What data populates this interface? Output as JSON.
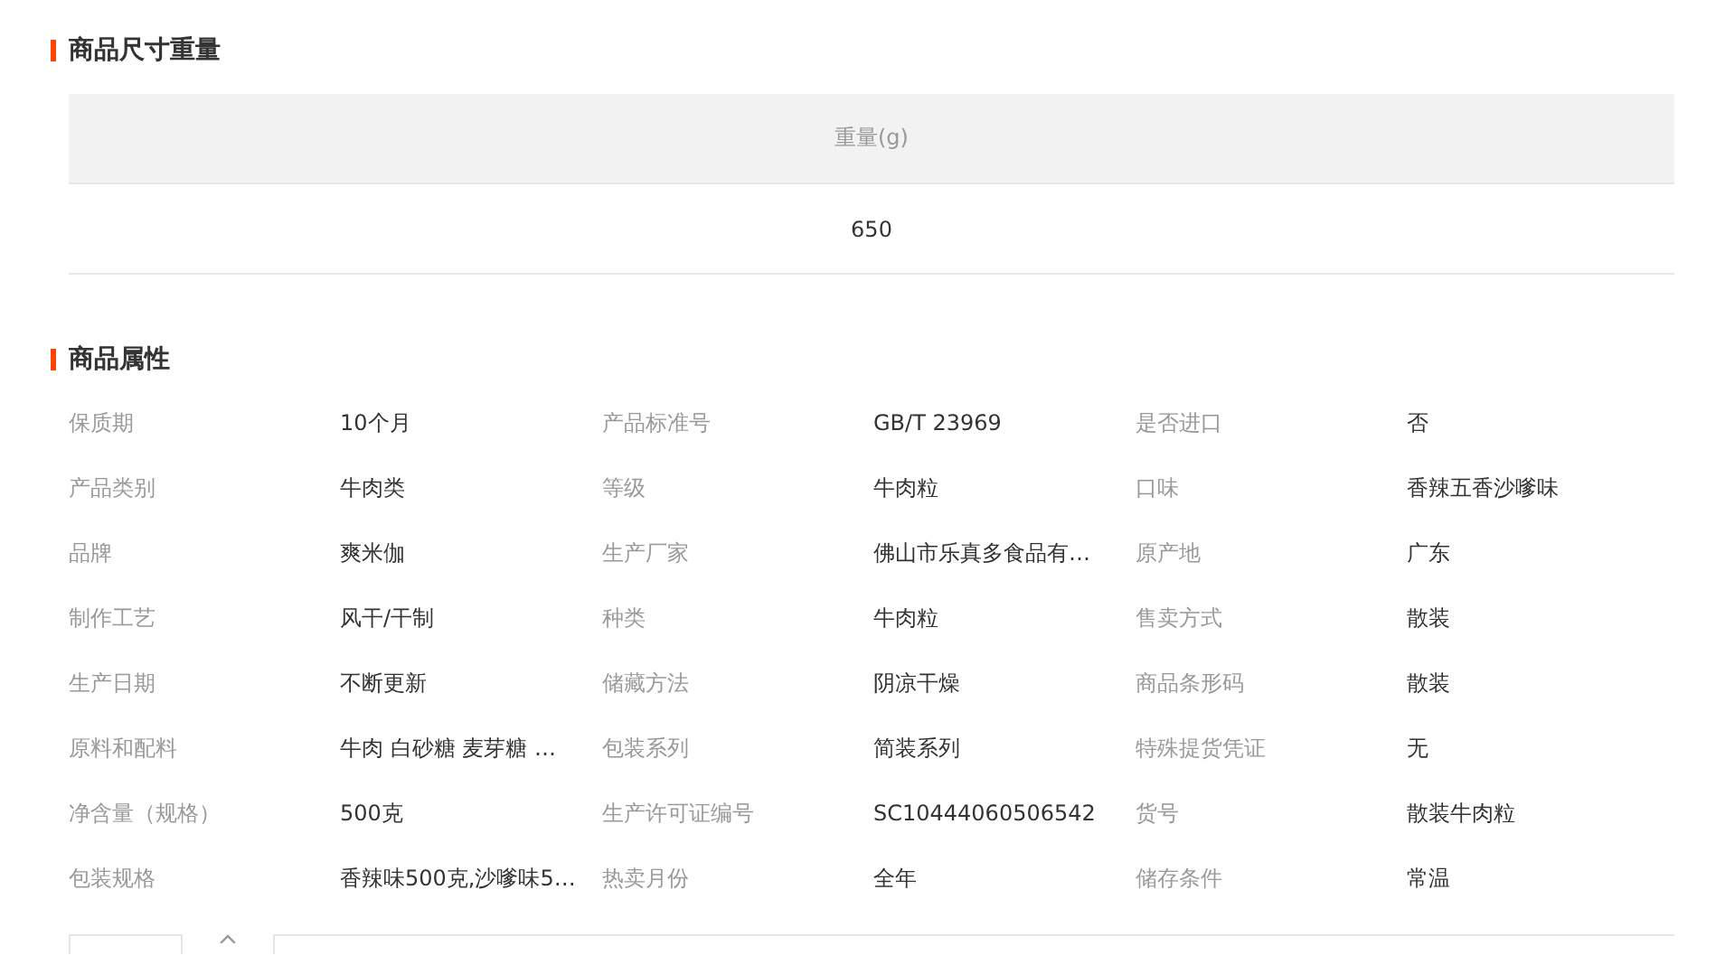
{
  "size_section": {
    "title": "商品尺寸重量",
    "columns": [
      "重量(g)"
    ],
    "rows": [
      [
        "650"
      ]
    ]
  },
  "attributes_section": {
    "title": "商品属性",
    "items": [
      {
        "label": "保质期",
        "value": "10个月"
      },
      {
        "label": "产品标准号",
        "value": "GB/T 23969"
      },
      {
        "label": "是否进口",
        "value": "否"
      },
      {
        "label": "产品类别",
        "value": "牛肉类"
      },
      {
        "label": "等级",
        "value": "牛肉粒"
      },
      {
        "label": "口味",
        "value": "香辣五香沙嗲味"
      },
      {
        "label": "品牌",
        "value": "爽米伽"
      },
      {
        "label": "生产厂家",
        "value": "佛山市乐真多食品有…"
      },
      {
        "label": "原产地",
        "value": "广东"
      },
      {
        "label": "制作工艺",
        "value": "风干/干制"
      },
      {
        "label": "种类",
        "value": "牛肉粒"
      },
      {
        "label": "售卖方式",
        "value": "散装"
      },
      {
        "label": "生产日期",
        "value": "不断更新"
      },
      {
        "label": "储藏方法",
        "value": "阴凉干燥"
      },
      {
        "label": "商品条形码",
        "value": "散装"
      },
      {
        "label": "原料和配料",
        "value": "牛肉 白砂糖 麦芽糖 …"
      },
      {
        "label": "包装系列",
        "value": "简装系列"
      },
      {
        "label": "特殊提货凭证",
        "value": "无"
      },
      {
        "label": "净含量（规格）",
        "value": "500克"
      },
      {
        "label": "生产许可证编号",
        "value": "SC10444060506542"
      },
      {
        "label": "货号",
        "value": "散装牛肉粒"
      },
      {
        "label": "包装规格",
        "value": "香辣味500克,沙嗲味5…"
      },
      {
        "label": "热卖月份",
        "value": "全年"
      },
      {
        "label": "储存条件",
        "value": "常温"
      }
    ]
  }
}
